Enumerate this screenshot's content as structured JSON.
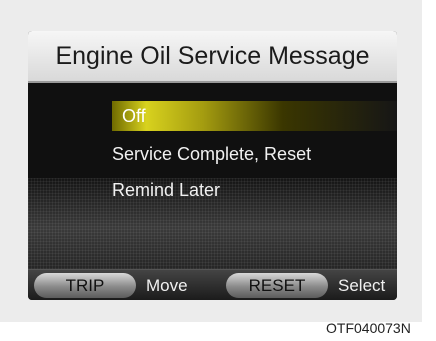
{
  "screen": {
    "title": "Engine Oil Service Message",
    "menu": [
      {
        "label": "Off",
        "selected": true
      },
      {
        "label": "Service Complete, Reset",
        "selected": false
      },
      {
        "label": "Remind Later",
        "selected": false
      }
    ],
    "footer": {
      "trip_button": "TRIP",
      "trip_action": "Move",
      "reset_button": "RESET",
      "reset_action": "Select"
    }
  },
  "caption": "OTF040073N",
  "colors": {
    "selection": "#d8d21e",
    "screen_bg": "#151515",
    "title_bg": "#f0f0f0"
  }
}
